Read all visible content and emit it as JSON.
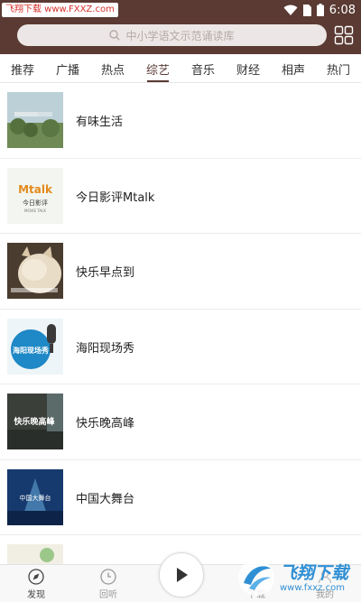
{
  "status_bar": {
    "watermark": "飞翔下载 www.FXXZ.com",
    "time": "6:08"
  },
  "search": {
    "placeholder": "中小学语文示范诵读库",
    "icon": "search-icon"
  },
  "tabs": [
    {
      "label": "推荐",
      "active": false
    },
    {
      "label": "广播",
      "active": false
    },
    {
      "label": "热点",
      "active": false
    },
    {
      "label": "综艺",
      "active": true
    },
    {
      "label": "音乐",
      "active": false
    },
    {
      "label": "财经",
      "active": false
    },
    {
      "label": "相声",
      "active": false
    },
    {
      "label": "热门",
      "active": false
    }
  ],
  "list": [
    {
      "title": "有味生活"
    },
    {
      "title": "今日影评Mtalk"
    },
    {
      "title": "快乐早点到"
    },
    {
      "title": "海阳现场秀"
    },
    {
      "title": "快乐晚高峰"
    },
    {
      "title": "中国大舞台"
    },
    {
      "title": ""
    }
  ],
  "thumb_text": {
    "mtalk_logo": "Mtalk",
    "mtalk_caption": "今日影评",
    "mtalk_sub": "MOVIE TALK",
    "haiyang": "海阳现场秀",
    "wangaofeng": "快乐晚高峰",
    "stage": "中国大舞台"
  },
  "bottom_nav": {
    "discover": "发现",
    "replay": "回听",
    "download": "下载",
    "mine": "我的"
  },
  "watermark_logo": {
    "text": "飞翔下载",
    "url": "www.fxxz.com"
  },
  "colors": {
    "header": "#5a3a33",
    "accent_tab": "#5a3a33",
    "watermark_blue": "#2f8fd4"
  }
}
